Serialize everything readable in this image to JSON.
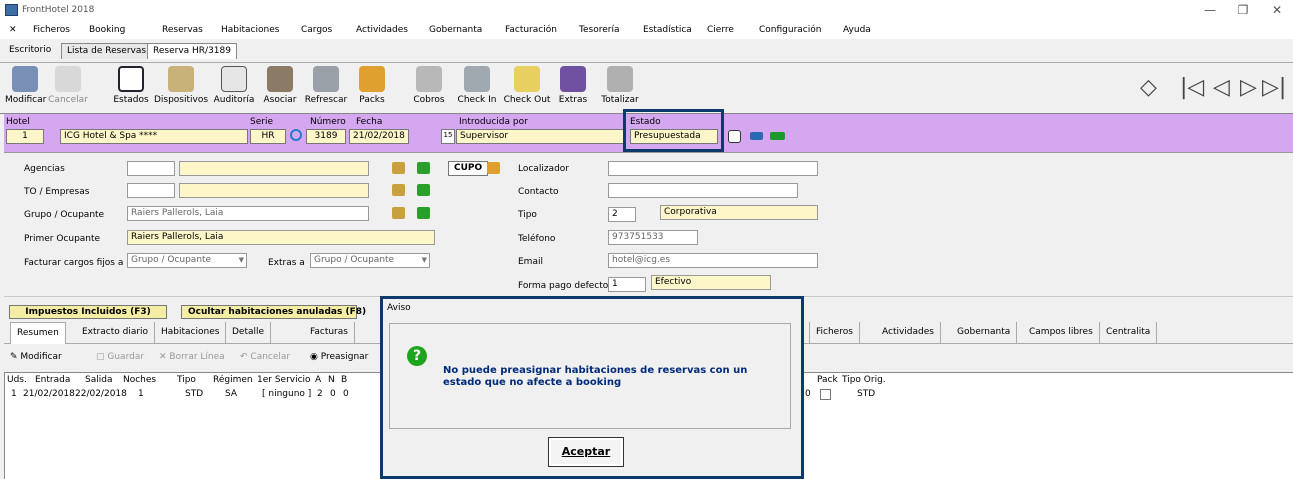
{
  "window": {
    "title": "FrontHotel 2018",
    "controls": [
      "—",
      "❐",
      "✕"
    ]
  },
  "menu": [
    "Ficheros",
    "Booking",
    "Reservas",
    "Habitaciones",
    "Cargos",
    "Actividades",
    "Gobernanta",
    "Facturación",
    "Tesorería",
    "Estadística",
    "Cierre",
    "Configuración",
    "Ayuda"
  ],
  "menu_close": "✕",
  "doc_tabs": [
    "Escritorio",
    "Lista de Reservas",
    "Reserva HR/3189"
  ],
  "toolbar": {
    "modificar": "Modificar",
    "cancelar": "Cancelar",
    "estados": "Estados",
    "dispositivos": "Dispositivos",
    "auditoria": "Auditoría",
    "asociar": "Asociar",
    "refrescar": "Refrescar",
    "packs": "Packs",
    "cobros": "Cobros",
    "checkin": "Check In",
    "checkout": "Check Out",
    "extras": "Extras",
    "totalizar": "Totalizar"
  },
  "nav": {
    "first": "|◁",
    "prev": "◁",
    "next": "▷",
    "last": "▷|",
    "diamond": "◇"
  },
  "header": {
    "hotel_label": "Hotel",
    "hotel_code": "1",
    "hotel_name": "ICG Hotel & Spa ****",
    "serie_label": "Serie",
    "serie": "HR",
    "numero_label": "Número",
    "numero": "3189",
    "fecha_label": "Fecha",
    "fecha": "21/02/2018",
    "cal": "15",
    "introducida_label": "Introducida por",
    "introducida": "Supervisor",
    "estado_label": "Estado",
    "estado": "Presupuestada"
  },
  "form": {
    "agencias_label": "Agencias",
    "to_label": "TO / Empresas",
    "grupo_label": "Grupo / Ocupante",
    "grupo_value": "Raiers Pallerols, Laia",
    "primer_label": "Primer Ocupante",
    "primer_value": "Raiers Pallerols, Laia",
    "facturar_label": "Facturar cargos fijos a",
    "facturar_value": "Grupo / Ocupante",
    "extras_label": "Extras a",
    "extras_value": "Grupo / Ocupante",
    "cupo": "CUPO",
    "localizador_label": "Localizador",
    "contacto_label": "Contacto",
    "tipo_label": "Tipo",
    "tipo_code": "2",
    "tipo_value": "Corporativa",
    "telefono_label": "Teléfono",
    "telefono_value": "973751533",
    "email_label": "Email",
    "email_value": "hotel@icg.es",
    "forma_label": "Forma pago defecto",
    "forma_code": "1",
    "forma_value": "Efectivo"
  },
  "buttons": {
    "impuestos": "Impuestos Incluidos (F3)",
    "ocultar": "Ocultar habitaciones anuladas (F8)"
  },
  "subtabs": [
    "Resumen",
    "Extracto diario",
    "Habitaciones",
    "Detalle",
    "Facturas",
    "Ficheros",
    "Actividades",
    "Gobernanta",
    "Campos libres",
    "Centralita"
  ],
  "gridbar": {
    "modificar": "Modificar",
    "guardar": "Guardar",
    "borrar": "Borrar Línea",
    "cancelar": "Cancelar",
    "preasignar": "Preasignar"
  },
  "grid": {
    "headers": [
      "Uds.",
      "Entrada",
      "Salida",
      "Noches",
      "Tipo",
      "Régimen",
      "1er Servicio",
      "A",
      "N",
      "B"
    ],
    "row": [
      "1",
      "21/02/2018",
      "22/02/2018",
      "1",
      "STD",
      "SA",
      "[ ninguno ]",
      "2",
      "0",
      "0"
    ],
    "right_headers": [
      "Pack",
      "Tipo Orig."
    ],
    "right_row": [
      "0",
      "STD"
    ]
  },
  "dialog": {
    "title": "Aviso",
    "icon": "?",
    "message": "No puede preasignar habitaciones de reservas con un estado que no afecte a booking",
    "ok": "Aceptar"
  },
  "colors": {
    "header_bg": "#d4a7f0",
    "highlight_border": "#0b3a6b",
    "field_yellow": "#fdf6c8",
    "dialog_text": "#002a7a"
  }
}
